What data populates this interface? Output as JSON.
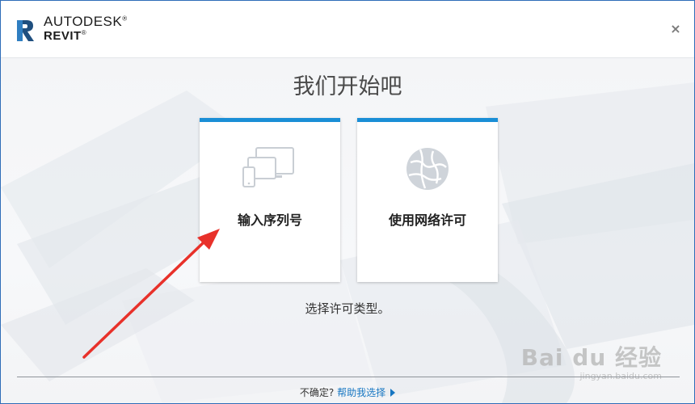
{
  "header": {
    "brand_top": "AUTODESK",
    "brand_registered": "®",
    "brand_bottom": "REVIT",
    "brand_trademark": "®",
    "close_symbol": "×"
  },
  "main": {
    "title": "我们开始吧",
    "cards": [
      {
        "label": "输入序列号",
        "icon": "devices-icon"
      },
      {
        "label": "使用网络许可",
        "icon": "network-globe-icon"
      }
    ],
    "subtitle": "选择许可类型。"
  },
  "footer": {
    "prefix": "不确定?",
    "link": "帮助我选择"
  },
  "watermark": {
    "logo": "Bai du 经验",
    "url": "jingyan.baidu.com"
  },
  "colors": {
    "accent": "#1a8ed6",
    "link": "#1676c2",
    "annotation_arrow": "#e8312a",
    "window_border": "#2f6db8"
  }
}
